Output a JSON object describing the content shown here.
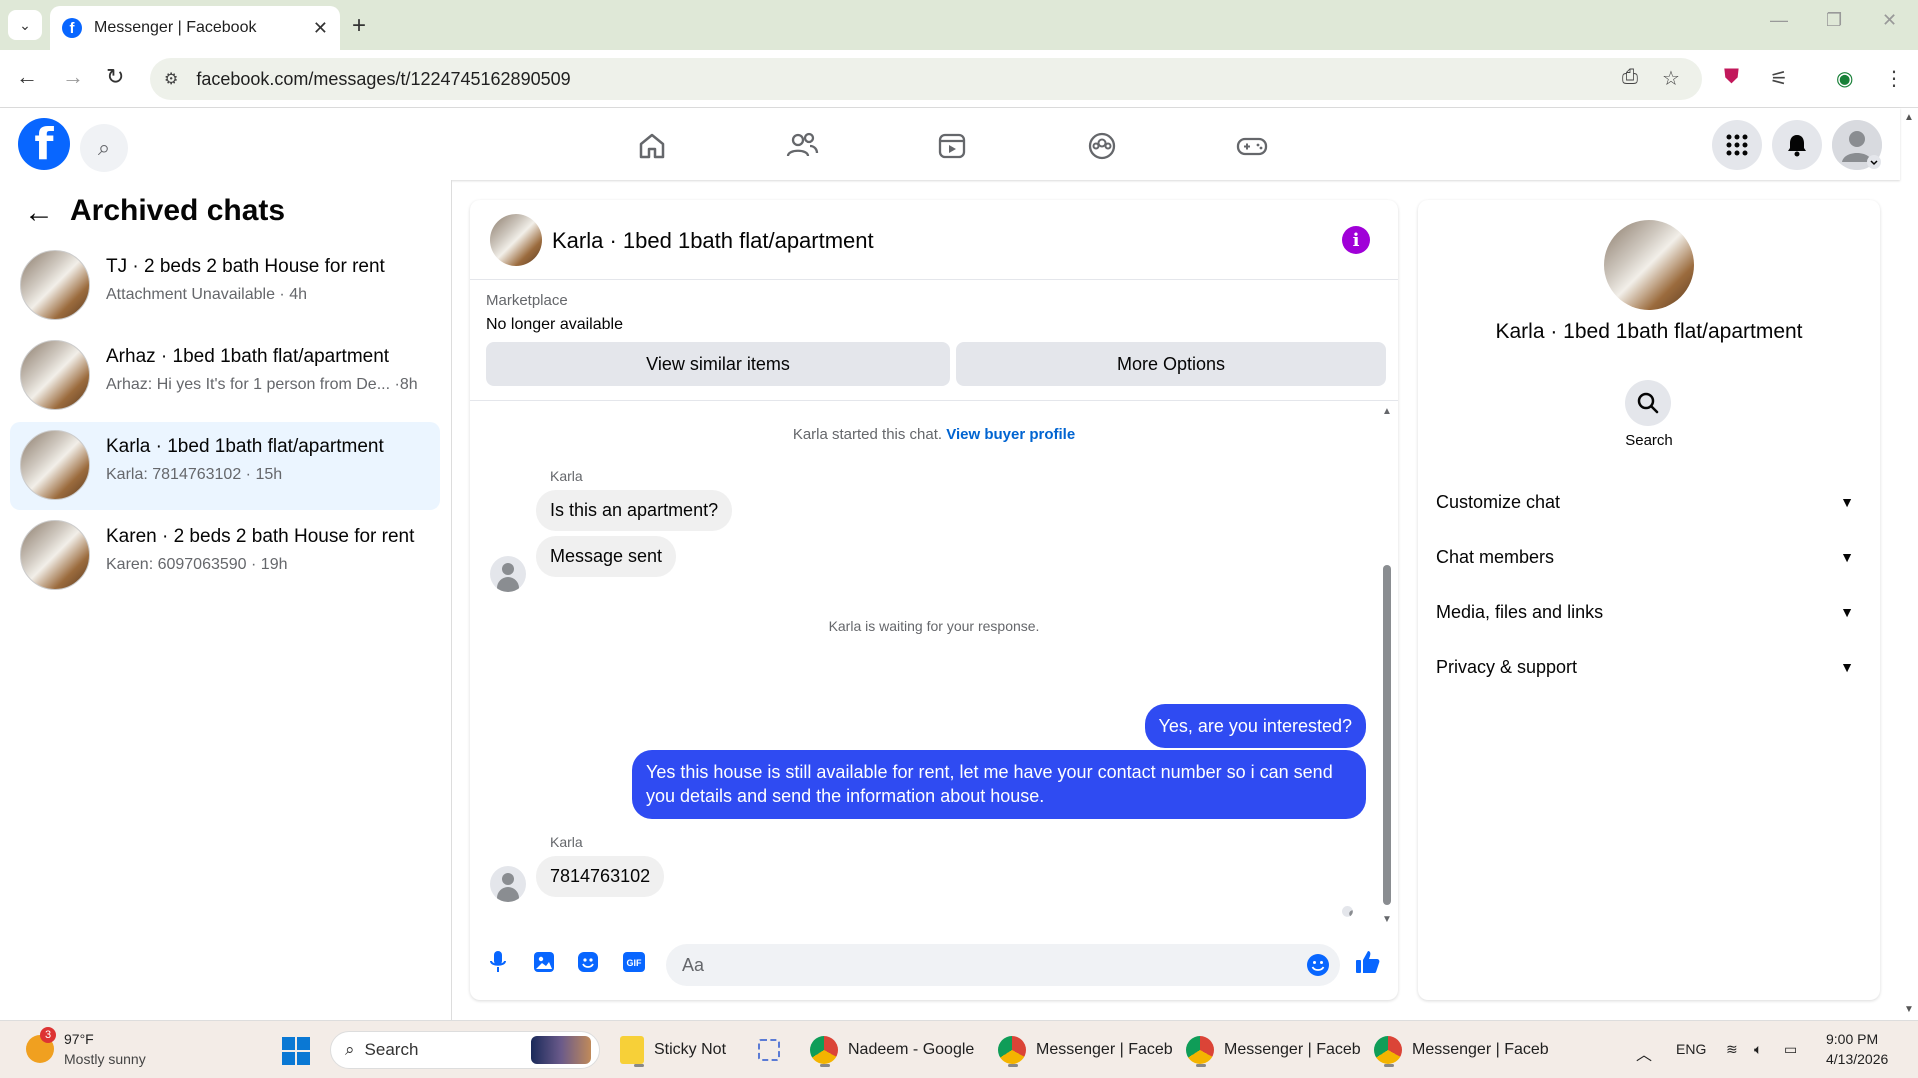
{
  "browser": {
    "tab_title": "Messenger | Facebook",
    "url": "facebook.com/messages/t/1224745162890509"
  },
  "left": {
    "title": "Archived chats",
    "chats": [
      {
        "name": "TJ · 2 beds 2 bath House for rent",
        "sub": "Attachment Unavailable · 4h"
      },
      {
        "name": "Arhaz · 1bed 1bath flat/apartment",
        "sub": "Arhaz: Hi yes It's for 1 person from De... ·8h"
      },
      {
        "name": "Karla · 1bed 1bath flat/apartment",
        "sub": "Karla: 7814763102 · 15h"
      },
      {
        "name": "Karen · 2 beds 2 bath House for rent",
        "sub": "Karen: 6097063590 · 19h"
      }
    ]
  },
  "chat": {
    "title": "Karla · 1bed 1bath flat/apartment",
    "marketplace_label": "Marketplace",
    "marketplace_status": "No longer available",
    "btn_similar": "View similar items",
    "btn_more": "More Options",
    "started_text": "Karla started this chat.",
    "buyer_profile_link": "View buyer profile",
    "sender": "Karla",
    "msg1": "Is this an apartment?",
    "msg2": "Message sent",
    "waiting_text": "Karla is waiting for your response.",
    "out1": "Yes, are you interested?",
    "out2": "Yes this house is still available for rent, let me have your contact number so i can send you details and send the information about house.",
    "sender2": "Karla",
    "msg3": "7814763102",
    "composer_placeholder": "Aa"
  },
  "right": {
    "title": "Karla · 1bed 1bath flat/apartment",
    "search_label": "Search",
    "sections": [
      "Customize chat",
      "Chat members",
      "Media, files and links",
      "Privacy & support"
    ]
  },
  "taskbar": {
    "badge": "3",
    "temp": "97°F",
    "condition": "Mostly sunny",
    "search": "Search",
    "apps": [
      "Sticky Not",
      "Nadeem - Google",
      "Messenger | Faceb",
      "Messenger | Faceb",
      "Messenger | Faceb"
    ],
    "lang": "ENG",
    "time": "9:00 PM",
    "date": "4/13/2026"
  },
  "colors": {
    "brand": "#0866ff",
    "outgoing_bubble": "#2f4bf2",
    "info_icon": "#a000d8"
  }
}
